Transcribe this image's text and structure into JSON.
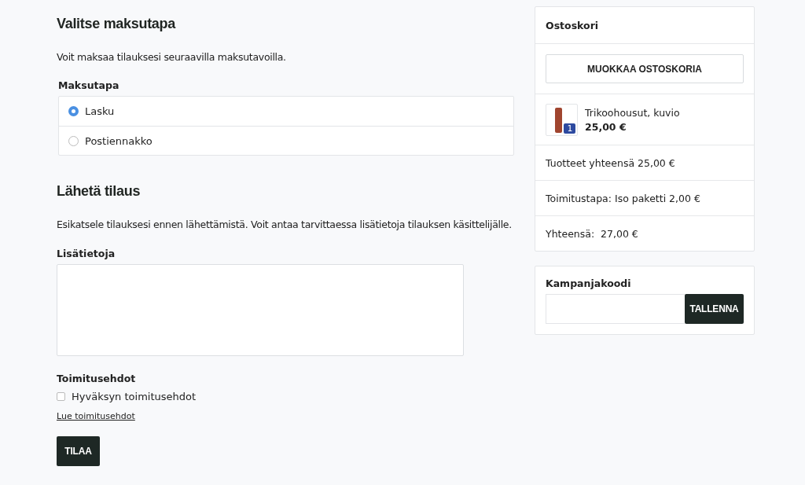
{
  "payment": {
    "title": "Valitse maksutapa",
    "intro": "Voit maksaa tilauksesi seuraavilla maksutavoilla.",
    "label": "Maksutapa",
    "options": [
      {
        "label": "Lasku",
        "selected": true
      },
      {
        "label": "Postiennakko",
        "selected": false
      }
    ]
  },
  "submit": {
    "title": "Lähetä tilaus",
    "intro": "Esikatsele tilauksesi ennen lähettämistä. Voit antaa tarvittaessa lisätietoja tilauksen käsittelijälle.",
    "notes_label": "Lisätietoja",
    "terms_label": "Toimitusehdot",
    "accept": {
      "label": "Hyväksyn toimitusehdot",
      "checked": false
    },
    "terms_link": "Lue toimitusehdot",
    "button": "TILAA"
  },
  "cart": {
    "title": "Ostoskori",
    "edit_button": "MUOKKAA OSTOSKORIA",
    "items": [
      {
        "name": "Trikoohousut, kuvio",
        "price": "25,00 €",
        "quantity": "1"
      }
    ],
    "totals": [
      "Tuotteet yhteensä 25,00 €",
      "Toimitustapa: Iso paketti 2,00 €",
      "Yhteensä:  27,00 €"
    ]
  },
  "campaign": {
    "label": "Kampanjakoodi",
    "button": "TALLENNA"
  }
}
